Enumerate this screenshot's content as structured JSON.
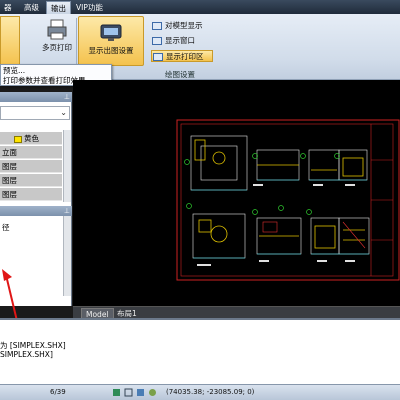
{
  "tabs": [
    {
      "label": "器"
    },
    {
      "label": "高级"
    },
    {
      "label": "输出"
    },
    {
      "label": "VIP功能"
    }
  ],
  "ribbon": {
    "multipage_print": "多页打印",
    "show_layout_settings": "显示出图设置",
    "model_display": "对模型显示",
    "show_window": "显示窗口",
    "show_print_area": "显示打印区",
    "group_label": "绘图设置"
  },
  "menu": {
    "preview": "预览...",
    "description": "打印参数并查看打印效果"
  },
  "left_panel": {
    "rows": [
      "黄色",
      "立面",
      "图层",
      "图层",
      "图层"
    ],
    "path_text": "径"
  },
  "layout_tabs": [
    "Model",
    "布局1"
  ],
  "command": {
    "line1": "为 [SIMPLEX.SHX]",
    "line2": "SIMPLEX.SHX]"
  },
  "status": {
    "page": "6/39",
    "coords": "(74035.38; -23085.09; 0)"
  },
  "colors": {
    "accent": "#f4c24d",
    "ribbon_bg": "#d1dcea",
    "canvas_bg": "#000000"
  }
}
